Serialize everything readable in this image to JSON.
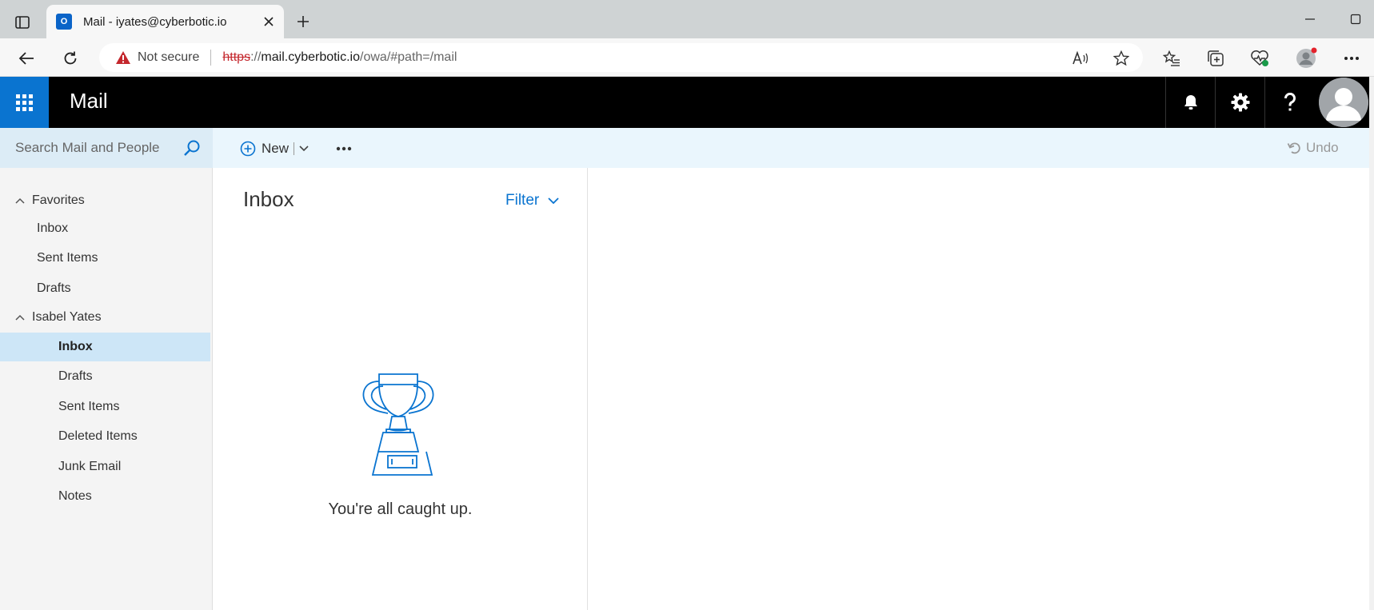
{
  "browser": {
    "tab": {
      "title": "Mail - iyates@cyberbotic.io",
      "favicon": "outlook-icon"
    },
    "address": {
      "security_label": "Not secure",
      "url_scheme": "https",
      "url_sep": "://",
      "url_host": "mail.cyberbotic.io",
      "url_path": "/owa/#path=/mail"
    }
  },
  "header": {
    "app_title": "Mail"
  },
  "command_bar": {
    "search_placeholder": "Search Mail and People",
    "new_label": "New",
    "undo_label": "Undo"
  },
  "folders": {
    "favorites": {
      "label": "Favorites",
      "items": [
        {
          "label": "Inbox"
        },
        {
          "label": "Sent Items"
        },
        {
          "label": "Drafts"
        }
      ]
    },
    "account": {
      "label": "Isabel Yates",
      "items": [
        {
          "label": "Inbox",
          "selected": true
        },
        {
          "label": "Drafts"
        },
        {
          "label": "Sent Items"
        },
        {
          "label": "Deleted Items"
        },
        {
          "label": "Junk Email"
        },
        {
          "label": "Notes"
        }
      ]
    }
  },
  "message_list": {
    "title": "Inbox",
    "filter_label": "Filter",
    "empty_message": "You're all caught up."
  },
  "colors": {
    "accent": "#0a74d0",
    "header_bg": "#000000",
    "selected_folder": "#cde6f7",
    "warning_red": "#c4272d"
  }
}
